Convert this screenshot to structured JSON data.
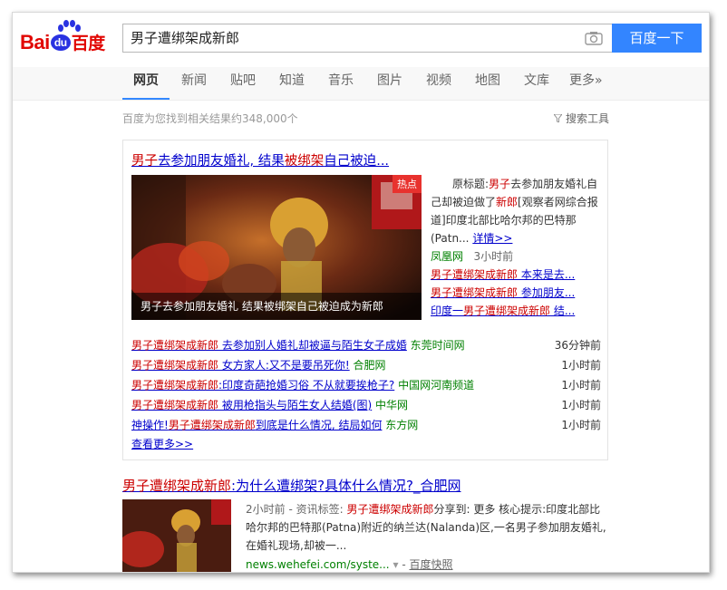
{
  "logo": {
    "bai": "Bai",
    "du": "du",
    "cn": "百度"
  },
  "search": {
    "query": "男子遭绑架成新郎",
    "button": "百度一下"
  },
  "nav": [
    "网页",
    "新闻",
    "贴吧",
    "知道",
    "音乐",
    "图片",
    "视频",
    "地图",
    "文库",
    "更多»"
  ],
  "result_count": "百度为您找到相关结果约348,000个",
  "tools": "搜索工具",
  "news_card": {
    "title_parts": [
      "男子",
      "去参加朋友婚礼, 结果",
      "被绑架",
      "自己被迫..."
    ],
    "hot_badge": "热点",
    "image_caption": "男子去参加朋友婚礼 结果被绑架自己被迫成为新郎",
    "abstract_prefix": "原标题:",
    "abstract_hl1": "男子",
    "abstract_mid": "去参加朋友婚礼自己却被迫做了",
    "abstract_hl2": "新郎",
    "abstract_rest": "[观察者网综合报道]印度北部比哈尔邦的巴特那(Patn...",
    "detail": "详情>>",
    "source": "凤凰网",
    "time": "3小时前",
    "side_links": [
      {
        "hl": "男子遭绑架成新郎",
        "rest": " 本来是去..."
      },
      {
        "hl": "男子遭绑架成新郎",
        "rest": " 参加朋友..."
      },
      {
        "pre": "印度一",
        "hl": "男子遭绑架成新郎",
        "rest": " 结..."
      }
    ],
    "rows": [
      {
        "hl": "男子遭绑架成新郎",
        "rest": " 去参加别人婚礼却被逼与陌生女子成婚",
        "src": "东莞时间网",
        "time": "36分钟前"
      },
      {
        "hl": "男子遭绑架成新郎",
        "rest": " 女方家人:又不是要吊死你!",
        "src": "合肥网",
        "time": "1小时前"
      },
      {
        "hl": "男子遭绑架成新郎",
        "rest": ":印度奇葩抢婚习俗 不从就要挨枪子?",
        "src": "中国网河南频道",
        "time": "1小时前"
      },
      {
        "hl": "男子遭绑架成新郎",
        "rest": " 被用枪指头与陌生女人结婚(图)",
        "src": "中华网",
        "time": "1小时前"
      },
      {
        "pre": "神操作!",
        "hl": "男子遭绑架成新郎",
        "rest": "到底是什么情况, 结局如何",
        "src": "东方网",
        "time": "1小时前"
      }
    ],
    "more": "查看更多>>"
  },
  "result2": {
    "title_hl": "男子遭绑架成新郎",
    "title_rest": ":为什么遭绑架?具体什么情况?_合肥网",
    "meta": "2小时前 - 资讯标签: ",
    "meta_hl": "男子遭绑架成新郎",
    "meta_rest": "分享到: 更多 核心提示:印度北部比哈尔邦的巴特那(Patna)附近的纳兰达(Nalanda)区,一名男子参加朋友婚礼,在婚礼现场,却被一...",
    "url": "news.wehefei.com/syste...",
    "snapshot": "百度快照"
  }
}
